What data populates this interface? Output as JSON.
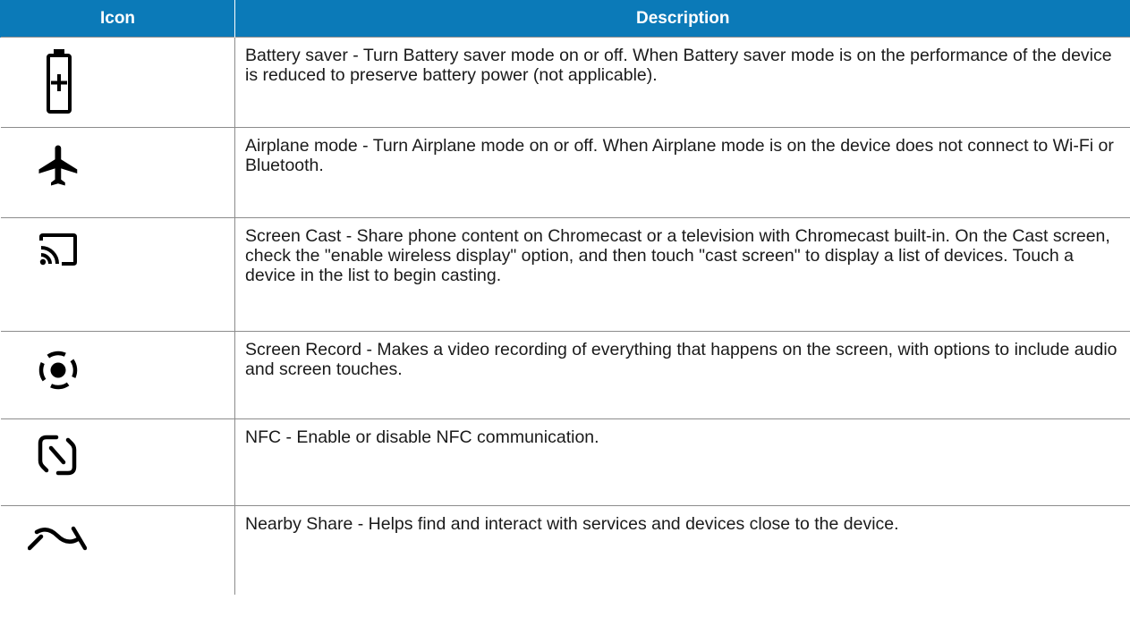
{
  "table": {
    "headers": {
      "icon": "Icon",
      "description": "Description"
    },
    "rows": [
      {
        "icon": "battery-saver-icon",
        "description": "Battery saver - Turn Battery saver mode on or off. When Battery saver mode is on the performance of the device is reduced to preserve battery power (not applicable)."
      },
      {
        "icon": "airplane-icon",
        "description": "Airplane mode - Turn Airplane mode on or off. When Airplane mode is on the device does not connect to Wi-Fi or Bluetooth."
      },
      {
        "icon": "screen-cast-icon",
        "description": "Screen Cast - Share phone content on Chromecast or a television with Chromecast built-in. On the Cast screen, check the \"enable wireless display\" option, and then touch \"cast screen\" to display a list of devices. Touch a device in the list to begin casting."
      },
      {
        "icon": "screen-record-icon",
        "description": "Screen Record - Makes a video recording of everything that happens on the screen, with options to include audio and screen touches."
      },
      {
        "icon": "nfc-icon",
        "description": "NFC - Enable or disable NFC communication."
      },
      {
        "icon": "nearby-share-icon",
        "description": "Nearby Share - Helps find and interact with services and devices close to the device."
      }
    ]
  },
  "colors": {
    "header_background": "#0b7ab8",
    "header_text": "#ffffff",
    "grid_lines": "#8c8c8c",
    "icon_color": "#000000",
    "body_text": "#1a1a1a"
  }
}
